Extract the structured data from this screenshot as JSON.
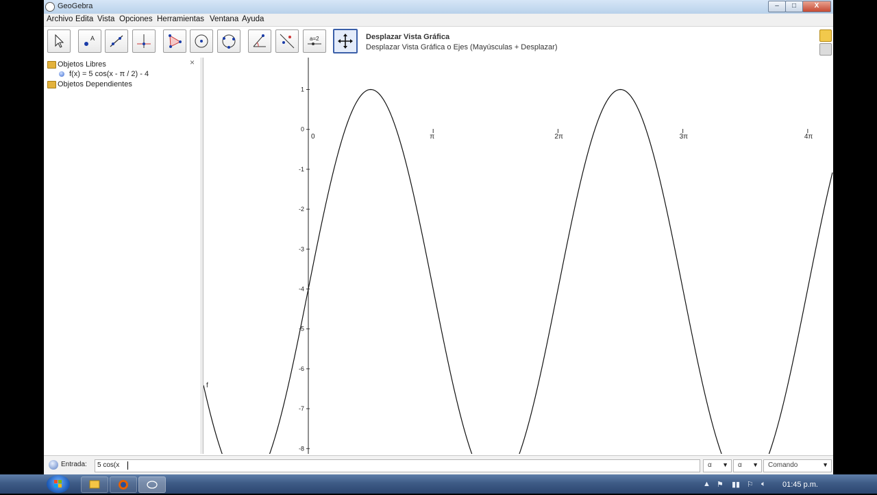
{
  "window": {
    "title": "GeoGebra"
  },
  "title_buttons": {
    "minimize": "‒",
    "maximize": "□",
    "close": "X"
  },
  "menu": [
    "Archivo",
    "Edita",
    "Vista",
    "Opciones",
    "Herramientas",
    "Ventana",
    "Ayuda"
  ],
  "toolbar": {
    "tools": [
      "move-tool",
      "point-tool",
      "line-tool",
      "perpendicular-tool",
      "polygon-tool",
      "circle-tool",
      "circle-three-points-tool",
      "angle-tool",
      "reflect-tool",
      "slider-tool",
      "move-graphics-view-tool"
    ],
    "selected": "move-graphics-view-tool",
    "tool_name": "Desplazar Vista Gráfica",
    "tool_help": "Desplazar Vista Gráfica o Ejes (Mayúsculas + Desplazar)"
  },
  "algebra": {
    "free_folder": "Objetos Libres",
    "function_text": "f(x) = 5 cos(x - π / 2) - 4",
    "dependent_folder": "Objetos Dependientes",
    "close": "×"
  },
  "graphics": {
    "x_ticks": [
      "0",
      "π",
      "2π",
      "3π",
      "4π"
    ],
    "y_ticks": [
      "1",
      "0",
      "-1",
      "-2",
      "-3",
      "-4",
      "-5",
      "-6",
      "-7",
      "-8"
    ],
    "curve_label": "f",
    "function": {
      "amplitude": 5,
      "phase": 1.5708,
      "shift": -4
    }
  },
  "input_bar": {
    "label": "Entrada:",
    "value": "5 cos(x",
    "combo1": "α",
    "combo2": "α",
    "combo3": "Comando"
  },
  "taskbar": {
    "clock": "01:45 p.m."
  }
}
